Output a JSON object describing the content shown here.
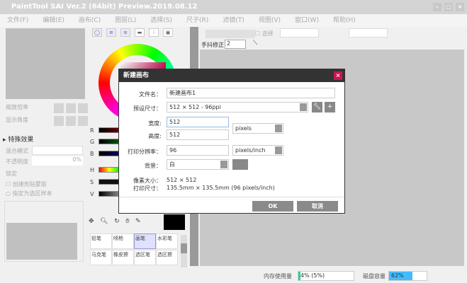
{
  "window": {
    "title": "PaintTool SAI Ver.2 (64bit) Preview.2019.08.12"
  },
  "menu": [
    "文件(F)",
    "编辑(E)",
    "画布(C)",
    "图层(L)",
    "选择(S)",
    "尺子(R)",
    "滤镜(T)",
    "视图(V)",
    "窗口(W)",
    "帮助(H)"
  ],
  "left": {
    "zoom_label": "缩放倍率",
    "angle_label": "显示角度",
    "effects_label": "特殊效果",
    "blend_label": "混合模式",
    "opacity_label": "不透明度",
    "opacity_value": "0%",
    "lock_label": "锁定",
    "clip_label": "创建剪贴蒙版",
    "sample_label": "指定为选区样本"
  },
  "color": {
    "sliders": [
      "R",
      "G",
      "B",
      "H",
      "S",
      "V"
    ]
  },
  "toolbar": {
    "select_label": "选择",
    "stabilizer_label": "手抖修正",
    "stabilizer_value": "2"
  },
  "tools": [
    "铅笔",
    "喷枪",
    "画笔",
    "水彩笔",
    "马克笔",
    "橡皮擦",
    "选区笔",
    "选区擦"
  ],
  "dialog": {
    "title": "新建画布",
    "filename_label": "文件名：",
    "filename": "新建画布1",
    "preset_label": "预设尺寸：",
    "preset": "512 × 512 - 96ppi",
    "width_label": "宽度:",
    "width": "512",
    "height_label": "高度:",
    "height": "512",
    "unit": "pixels",
    "res_label": "打印分辨率：",
    "res": "96",
    "res_unit": "pixels/inch",
    "bg_label": "背景：",
    "bg": "白",
    "pixel_size_label": "像素大小：",
    "pixel_size": "512 × 512",
    "print_size_label": "打印尺寸：",
    "print_size": "135.5mm × 135.5mm (96 pixels/inch)",
    "ok": "OK",
    "cancel": "取消"
  },
  "status": {
    "memory_label": "内存使用量",
    "memory_value": "4% (5%)",
    "memory_percent": 4,
    "disk_label": "磁盘容量",
    "disk_value": "62%",
    "disk_percent": 62
  }
}
